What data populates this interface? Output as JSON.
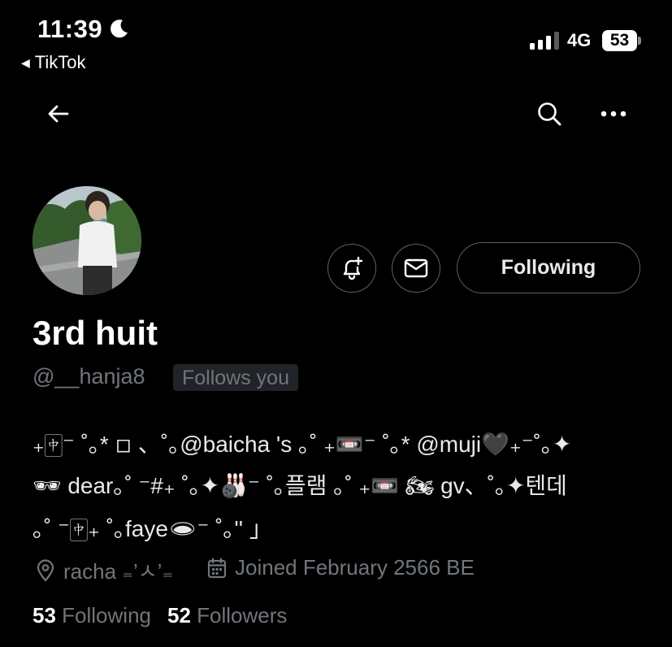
{
  "status_bar": {
    "time": "11:39",
    "back_app": "TikTok",
    "network": "4G",
    "battery": "53"
  },
  "icons": {
    "moon": "moon-icon",
    "back": "arrow-left-icon",
    "search": "search-icon",
    "more": "ellipsis-icon",
    "notify": "bell-plus-icon",
    "message": "envelope-icon",
    "location": "location-pin-icon",
    "calendar": "calendar-icon"
  },
  "profile": {
    "display_name": "3rd huit",
    "handle": "@__hanja8",
    "follows_you": "Follows you",
    "following_button": "Following",
    "bio": [
      "₊🀄︎⁻ ˚｡* ◽ 、˚｡@baicha 's ｡˚ ₊📼⁻ ˚｡* @muji🖤₊⁻˚｡✦",
      "🕶 dear｡˚ ⁻#₊ ˚｡✦🎳⁻ ˚｡플램 ｡˚ ₊📼 🏍 gv、˚｡✦텐데",
      "｡˚ ⁻🀄︎₊ ˚｡faye🕳⁻ ˚｡'' 」"
    ],
    "location": "racha ₌’ㅅ’₌",
    "joined": "Joined February 2566 BE",
    "following_count": "53",
    "following_label": "Following",
    "followers_count": "52",
    "followers_label": "Followers"
  },
  "colors": {
    "background": "#000000",
    "text_primary": "#e7e9ea",
    "text_secondary": "#71767b",
    "border": "#536471"
  }
}
